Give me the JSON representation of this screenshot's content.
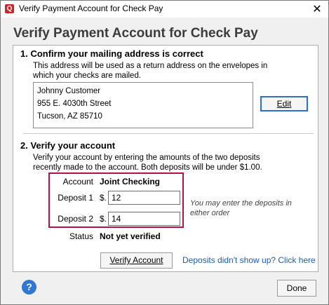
{
  "window": {
    "title": "Verify Payment Account for Check Pay",
    "app_icon_letter": "Q",
    "close_glyph": "✕"
  },
  "heading": "Verify Payment Account for Check Pay",
  "section1": {
    "title": "1. Confirm your mailing address is correct",
    "description_line1": "This address will be used as a return address on the envelopes in",
    "description_line2": "which your checks are mailed.",
    "address": [
      "Johnny Customer",
      "955 E. 4030th Street",
      "Tucson, AZ 85710"
    ],
    "edit_button": "Edit"
  },
  "section2": {
    "title": "2. Verify your account",
    "description_line1": "Verify your account by entering the amounts of the two deposits",
    "description_line2": "recently made to the account. Both deposits will be under $1.00.",
    "account_label": "Account",
    "account_value": "Joint Checking",
    "deposit1_label": "Deposit 1",
    "deposit2_label": "Deposit 2",
    "currency_prefix": "$.",
    "deposit1_value": "12",
    "deposit2_value": "14",
    "hint_line1": "You may enter the deposits in",
    "hint_line2": "either order",
    "status_label": "Status",
    "status_value": "Not yet verified",
    "verify_button": "Verify Account",
    "deposits_link": "Deposits didn't show up?  Click here"
  },
  "footer": {
    "help_glyph": "?",
    "done_button": "Done"
  },
  "colors": {
    "highlight_border": "#b3143f",
    "link": "#1a5fa8",
    "help_icon": "#2f77d1",
    "app_icon": "#d2232a"
  }
}
